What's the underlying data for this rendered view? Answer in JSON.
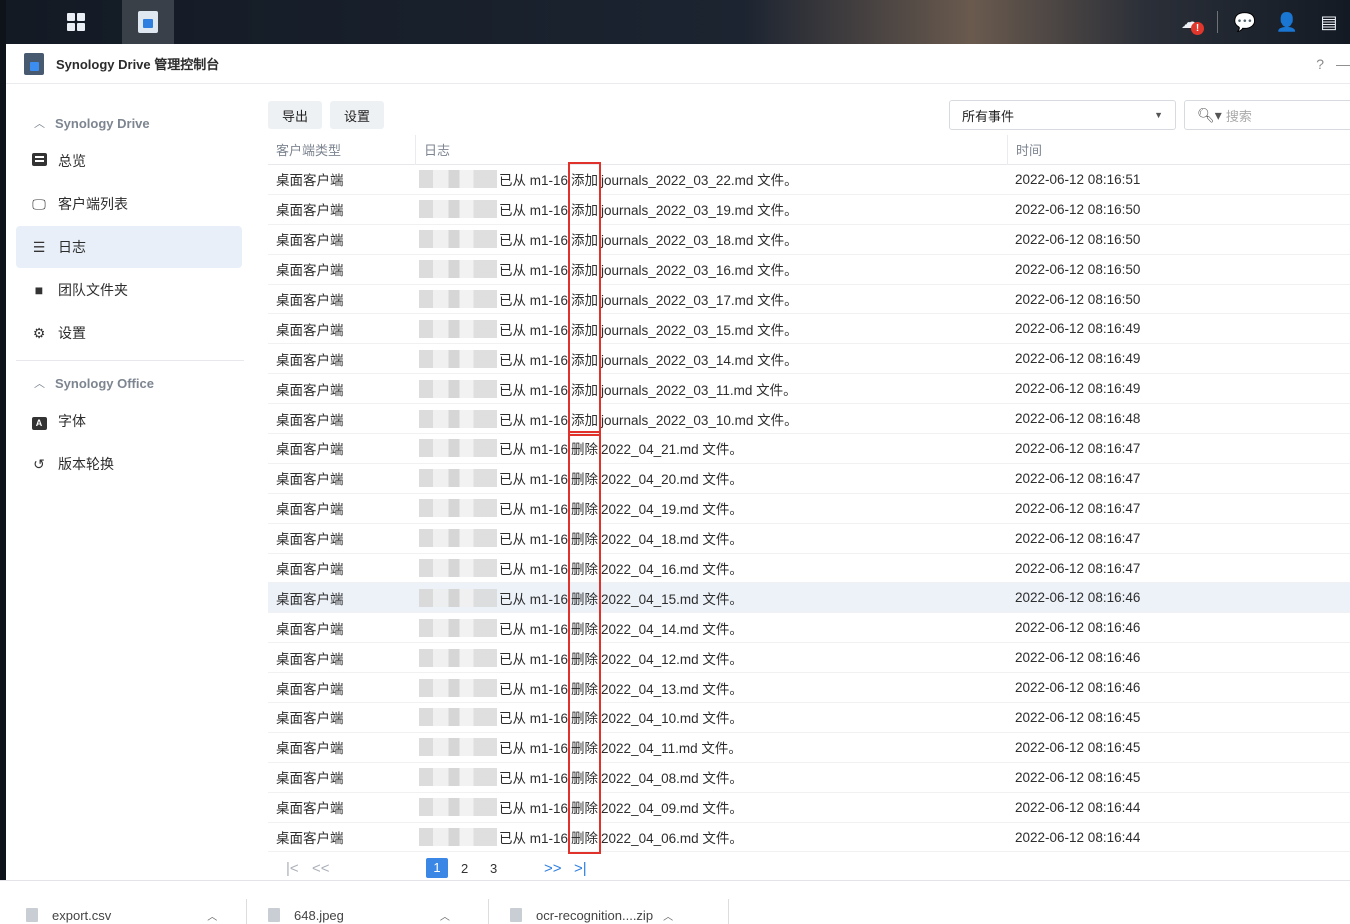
{
  "window": {
    "title": "Synology Drive 管理控制台",
    "help": "?",
    "minimize": "—"
  },
  "sidebar": {
    "groups": [
      {
        "title": "Synology Drive",
        "items": [
          "总览",
          "客户端列表",
          "日志",
          "团队文件夹",
          "设置"
        ]
      },
      {
        "title": "Synology Office",
        "items": [
          "字体",
          "版本轮换"
        ]
      }
    ],
    "selected": "日志"
  },
  "toolbar": {
    "export_label": "导出",
    "settings_label": "设置",
    "filter_value": "所有事件",
    "search_placeholder": "搜索"
  },
  "table": {
    "columns": [
      "客户端类型",
      "日志",
      "时间"
    ],
    "rows": [
      {
        "client": "桌面客户端",
        "log_prefix": "已从 m1-16 ",
        "action": "添加",
        "file": "journals_2022_03_22.md 文件。",
        "time": "2022-06-12 08:16:51"
      },
      {
        "client": "桌面客户端",
        "log_prefix": "已从 m1-16 ",
        "action": "添加",
        "file": "journals_2022_03_19.md 文件。",
        "time": "2022-06-12 08:16:50"
      },
      {
        "client": "桌面客户端",
        "log_prefix": "已从 m1-16 ",
        "action": "添加",
        "file": "journals_2022_03_18.md 文件。",
        "time": "2022-06-12 08:16:50"
      },
      {
        "client": "桌面客户端",
        "log_prefix": "已从 m1-16 ",
        "action": "添加",
        "file": "journals_2022_03_16.md 文件。",
        "time": "2022-06-12 08:16:50"
      },
      {
        "client": "桌面客户端",
        "log_prefix": "已从 m1-16 ",
        "action": "添加",
        "file": "journals_2022_03_17.md 文件。",
        "time": "2022-06-12 08:16:50"
      },
      {
        "client": "桌面客户端",
        "log_prefix": "已从 m1-16 ",
        "action": "添加",
        "file": "journals_2022_03_15.md 文件。",
        "time": "2022-06-12 08:16:49"
      },
      {
        "client": "桌面客户端",
        "log_prefix": "已从 m1-16 ",
        "action": "添加",
        "file": "journals_2022_03_14.md 文件。",
        "time": "2022-06-12 08:16:49"
      },
      {
        "client": "桌面客户端",
        "log_prefix": "已从 m1-16 ",
        "action": "添加",
        "file": "journals_2022_03_11.md 文件。",
        "time": "2022-06-12 08:16:49"
      },
      {
        "client": "桌面客户端",
        "log_prefix": "已从 m1-16 ",
        "action": "添加",
        "file": "journals_2022_03_10.md 文件。",
        "time": "2022-06-12 08:16:48"
      },
      {
        "client": "桌面客户端",
        "log_prefix": "已从 m1-16 ",
        "action": "删除",
        "file": "2022_04_21.md 文件。",
        "time": "2022-06-12 08:16:47"
      },
      {
        "client": "桌面客户端",
        "log_prefix": "已从 m1-16 ",
        "action": "删除",
        "file": "2022_04_20.md 文件。",
        "time": "2022-06-12 08:16:47"
      },
      {
        "client": "桌面客户端",
        "log_prefix": "已从 m1-16 ",
        "action": "删除",
        "file": "2022_04_19.md 文件。",
        "time": "2022-06-12 08:16:47"
      },
      {
        "client": "桌面客户端",
        "log_prefix": "已从 m1-16 ",
        "action": "删除",
        "file": "2022_04_18.md 文件。",
        "time": "2022-06-12 08:16:47"
      },
      {
        "client": "桌面客户端",
        "log_prefix": "已从 m1-16 ",
        "action": "删除",
        "file": "2022_04_16.md 文件。",
        "time": "2022-06-12 08:16:47"
      },
      {
        "client": "桌面客户端",
        "log_prefix": "已从 m1-16 ",
        "action": "删除",
        "file": "2022_04_15.md 文件。",
        "time": "2022-06-12 08:16:46"
      },
      {
        "client": "桌面客户端",
        "log_prefix": "已从 m1-16 ",
        "action": "删除",
        "file": "2022_04_14.md 文件。",
        "time": "2022-06-12 08:16:46"
      },
      {
        "client": "桌面客户端",
        "log_prefix": "已从 m1-16 ",
        "action": "删除",
        "file": "2022_04_12.md 文件。",
        "time": "2022-06-12 08:16:46"
      },
      {
        "client": "桌面客户端",
        "log_prefix": "已从 m1-16 ",
        "action": "删除",
        "file": "2022_04_13.md 文件。",
        "time": "2022-06-12 08:16:46"
      },
      {
        "client": "桌面客户端",
        "log_prefix": "已从 m1-16 ",
        "action": "删除",
        "file": "2022_04_10.md 文件。",
        "time": "2022-06-12 08:16:45"
      },
      {
        "client": "桌面客户端",
        "log_prefix": "已从 m1-16 ",
        "action": "删除",
        "file": "2022_04_11.md 文件。",
        "time": "2022-06-12 08:16:45"
      },
      {
        "client": "桌面客户端",
        "log_prefix": "已从 m1-16 ",
        "action": "删除",
        "file": "2022_04_08.md 文件。",
        "time": "2022-06-12 08:16:45"
      },
      {
        "client": "桌面客户端",
        "log_prefix": "已从 m1-16 ",
        "action": "删除",
        "file": "2022_04_09.md 文件。",
        "time": "2022-06-12 08:16:44"
      },
      {
        "client": "桌面客户端",
        "log_prefix": "已从 m1-16 ",
        "action": "删除",
        "file": "2022_04_06.md 文件。",
        "time": "2022-06-12 08:16:44"
      }
    ],
    "highlighted_row_index": 14
  },
  "pagination": {
    "first": "|<",
    "prev": "<<",
    "pages": [
      "1",
      "2",
      "3"
    ],
    "current": "1",
    "next": ">>",
    "last": ">|"
  },
  "downloads": {
    "items": [
      "export.csv",
      "648.jpeg",
      "ocr-recognition....zip"
    ]
  },
  "annotation": {
    "color": "#e0312a"
  },
  "colors": {
    "accent": "#3b87e6",
    "selected_nav": "#e8eff8",
    "row_highlight": "#edf2f9"
  }
}
